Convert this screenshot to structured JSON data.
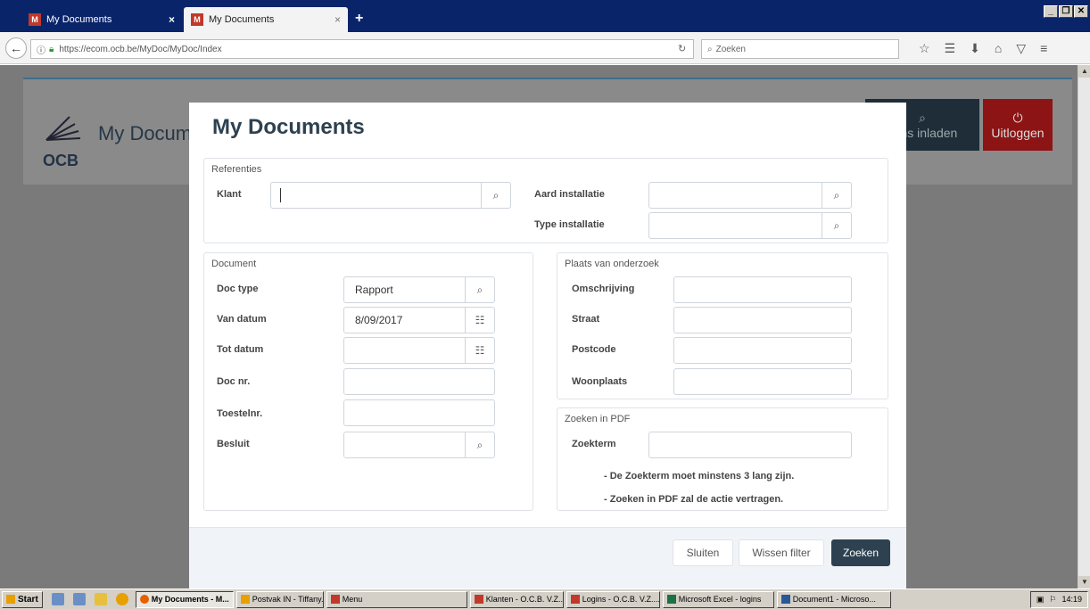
{
  "browser": {
    "tabs": [
      {
        "label": "My Documents",
        "close": "×"
      },
      {
        "label": "My Documents",
        "close": "×"
      }
    ],
    "new_tab": "+",
    "url": "https://ecom.ocb.be/MyDoc/MyDoc/Index",
    "search_placeholder": "Zoeken"
  },
  "background": {
    "app_title": "My Documents",
    "logo_text": "OCB",
    "header_button_load": "vens inladen",
    "header_button_logout": "Uitloggen"
  },
  "modal": {
    "title": "My Documents",
    "referenties": {
      "title": "Referenties",
      "klant_label": "Klant",
      "klant_value": "",
      "aard_label": "Aard installatie",
      "aard_value": "",
      "type_label": "Type installatie",
      "type_value": ""
    },
    "document": {
      "title": "Document",
      "doctype_label": "Doc type",
      "doctype_value": "Rapport",
      "vandatum_label": "Van datum",
      "vandatum_value": "8/09/2017",
      "totdatum_label": "Tot datum",
      "totdatum_value": "",
      "docnr_label": "Doc nr.",
      "docnr_value": "",
      "toestelnr_label": "Toestelnr.",
      "toestelnr_value": "",
      "besluit_label": "Besluit",
      "besluit_value": ""
    },
    "plaats": {
      "title": "Plaats van onderzoek",
      "omschrijving_label": "Omschrijving",
      "omschrijving_value": "",
      "straat_label": "Straat",
      "straat_value": "",
      "postcode_label": "Postcode",
      "postcode_value": "",
      "woonplaats_label": "Woonplaats",
      "woonplaats_value": ""
    },
    "pdf": {
      "title": "Zoeken in PDF",
      "zoekterm_label": "Zoekterm",
      "zoekterm_value": "",
      "hint1": "- De Zoekterm moet minstens 3 lang zijn.",
      "hint2": "- Zoeken in PDF zal de actie vertragen."
    },
    "buttons": {
      "close": "Sluiten",
      "clear": "Wissen filter",
      "search": "Zoeken"
    }
  },
  "taskbar": {
    "start": "Start",
    "items": [
      "My Documents - M...",
      "Postvak IN - Tiffany....",
      "Menu",
      "Klanten - O.C.B. V.Z...",
      "Logins - O.C.B. V.Z....",
      "Microsoft Excel - logins",
      "Document1 - Microso..."
    ],
    "clock": "14:19"
  },
  "colors": {
    "primary": "#2d4150",
    "logout": "#8c1414",
    "titlebar": "#0a246a"
  }
}
